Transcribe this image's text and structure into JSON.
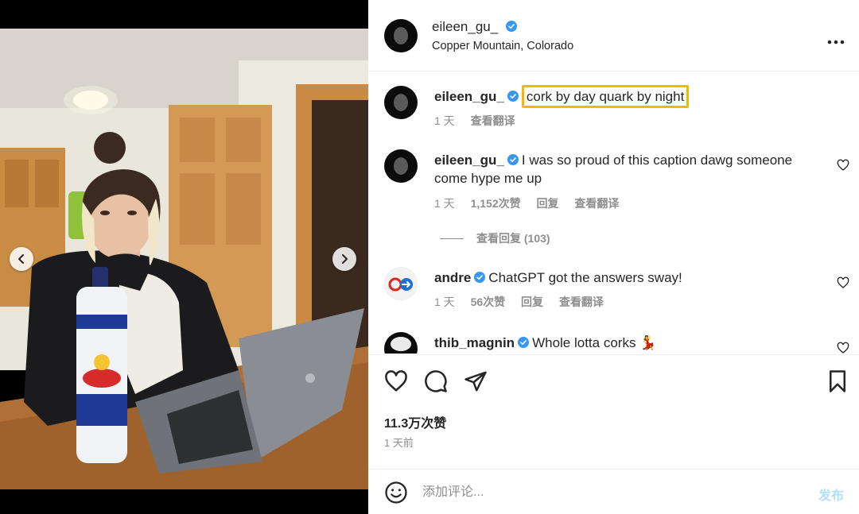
{
  "header": {
    "username": "eileen_gu_",
    "location": "Copper Mountain, Colorado",
    "more_icon": "more-horizontal-icon"
  },
  "caption": {
    "username": "eileen_gu_",
    "text": "cork by day quark by night",
    "time": "1 天",
    "translate": "查看翻译"
  },
  "comments": [
    {
      "username": "eileen_gu_",
      "text": "I was so proud of this caption dawg someone come hype me up",
      "time": "1 天",
      "likes": "1,152次赞",
      "reply": "回复",
      "translate": "查看翻译",
      "view_replies": "查看回复 (103)"
    },
    {
      "username": "andre",
      "text": "ChatGPT got the answers sway!",
      "time": "1 天",
      "likes": "56次赞",
      "reply": "回复",
      "translate": "查看翻译"
    },
    {
      "username": "thib_magnin",
      "text": "Whole lotta corks 💃"
    }
  ],
  "actions": {
    "likes_count": "11.3万次赞",
    "posted_ago": "1 天前"
  },
  "compose": {
    "placeholder": "添加评论...",
    "post_label": "发布"
  },
  "carousel": {
    "slide_count": 4,
    "active_slide": 3
  },
  "colors": {
    "verified": "#3897f0",
    "highlight": "#f5b800",
    "post_button": "#b2dffc",
    "muted": "#8e8e8e"
  }
}
